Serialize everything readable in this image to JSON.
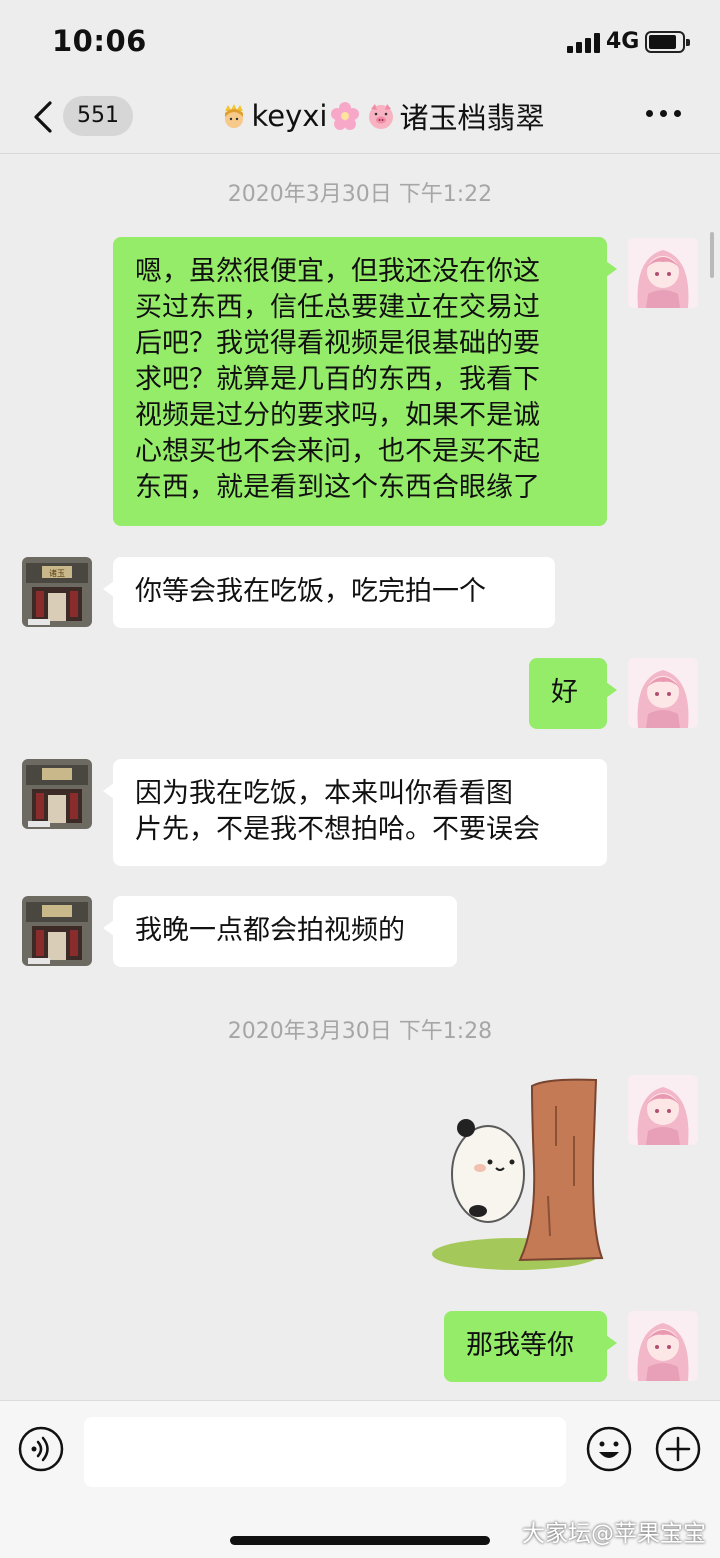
{
  "status_bar": {
    "time": "10:06",
    "network": "4G",
    "battery_level": 0.75
  },
  "nav": {
    "unread_count": "551",
    "title": "keyxi",
    "title_suffix": "诸玉档翡翠",
    "title_emojis": [
      "princess-emoji",
      "cherry-blossom-emoji",
      "pig-emoji"
    ]
  },
  "timestamps": [
    "2020年3月30日 下午1:22",
    "2020年3月30日 下午1:28"
  ],
  "messages": [
    {
      "side": "out",
      "lines": [
        "嗯，虽然很便宜，但我还没在你这",
        "买过东西，信任总要建立在交易过",
        "后吧？我觉得看视频是很基础的要",
        "求吧？就算是几百的东西，我看下",
        "视频是过分的要求吗，如果不是诚",
        "心想买也不会来问，也不是买不起",
        "东西，就是看到这个东西合眼缘了"
      ]
    },
    {
      "side": "in",
      "lines": [
        "你等会我在吃饭，吃完拍一个"
      ]
    },
    {
      "side": "out",
      "lines": [
        "好"
      ]
    },
    {
      "side": "in",
      "lines": [
        "因为我在吃饭，本来叫你看看图",
        "片先，不是我不想拍哈。不要误会"
      ]
    },
    {
      "side": "in",
      "lines": [
        "我晚一点都会拍视频的"
      ]
    },
    {
      "side": "out",
      "type": "sticker",
      "sticker": "panda-behind-tree-sticker"
    },
    {
      "side": "out",
      "lines": [
        "那我等你"
      ]
    }
  ],
  "avatars": {
    "self": "anime-girl-avatar",
    "contact": "shop-storefront-avatar",
    "shop_sign": "诸玉"
  },
  "input_bar": {
    "placeholder": ""
  },
  "watermark": "大家坛@苹果宝宝",
  "colors": {
    "outgoing_bubble": "#95ec69",
    "incoming_bubble": "#ffffff",
    "background": "#ededed"
  }
}
